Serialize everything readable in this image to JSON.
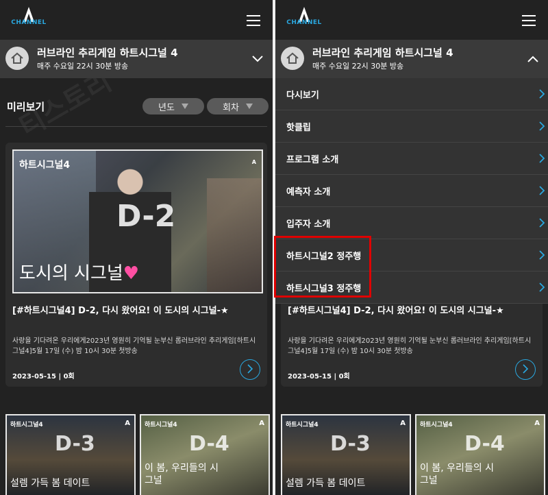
{
  "header": {
    "logo_text": "CHANNEL",
    "menu_icon": "hamburger-icon"
  },
  "program": {
    "title": "러브라인 추리게임 하트시그널 4",
    "subtitle": "매주 수요일 22시 30분 방송"
  },
  "preview": {
    "section_title": "미리보기",
    "filters": [
      "년도",
      "회차"
    ]
  },
  "featured": {
    "thumb_logo": "하트시그널4",
    "thumb_badge": "D-2",
    "thumb_caption": "도시의 시그널",
    "title": "[#하트시그널4] D-2, 다시 왔어요! 이 도시의 시그널-★",
    "description": "사랑을 기다려온 우리에게2023년 영원히 기억될 눈부신 롭러브라인 추리게임[하트시그널4]5월 17일 (수) 밤 10시 30분 첫방송",
    "date": "2023-05-15 | 0회"
  },
  "thumbs": [
    {
      "logo": "하트시그널4",
      "badge": "D-3",
      "caption": "설렘 가득 봄 데이트"
    },
    {
      "logo": "하트시그널4",
      "badge": "D-4",
      "caption": "이 봄, 우리들의 시그널"
    }
  ],
  "dropdown_menu": [
    "다시보기",
    "핫클립",
    "프로그램 소개",
    "예측자 소개",
    "입주자 소개",
    "하트시그널2 정주행",
    "하트시그널3 정주행"
  ],
  "colors": {
    "accent": "#2aa8e0",
    "highlight": "#e00000",
    "background": "#222222"
  }
}
